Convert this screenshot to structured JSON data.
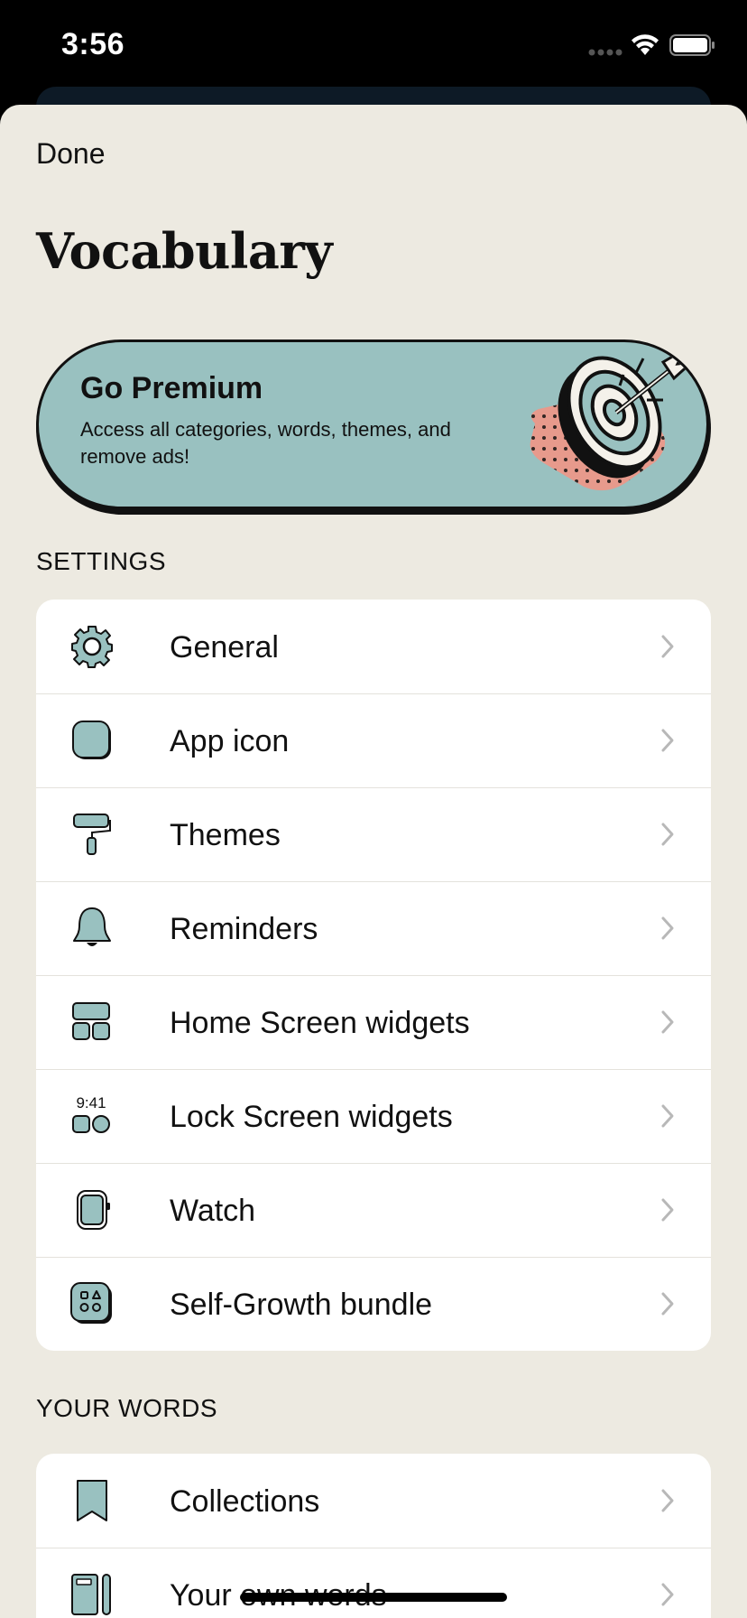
{
  "status_bar": {
    "time": "3:56"
  },
  "header": {
    "done_label": "Done",
    "title": "Vocabulary"
  },
  "premium": {
    "title": "Go Premium",
    "subtitle": "Access all categories, words, themes, and remove ads!"
  },
  "settings": {
    "section_label": "SETTINGS",
    "items": [
      {
        "label": "General",
        "icon": "gear-icon"
      },
      {
        "label": "App icon",
        "icon": "app-icon-icon"
      },
      {
        "label": "Themes",
        "icon": "paint-roller-icon"
      },
      {
        "label": "Reminders",
        "icon": "bell-icon"
      },
      {
        "label": "Home Screen widgets",
        "icon": "widgets-icon"
      },
      {
        "label": "Lock Screen widgets",
        "icon": "lock-screen-widgets-icon",
        "icon_text": "9:41"
      },
      {
        "label": "Watch",
        "icon": "watch-icon"
      },
      {
        "label": "Self-Growth bundle",
        "icon": "bundle-icon"
      }
    ]
  },
  "your_words": {
    "section_label": "YOUR WORDS",
    "items": [
      {
        "label": "Collections",
        "icon": "bookmark-icon"
      },
      {
        "label": "Your own words",
        "icon": "notebook-pencil-icon"
      }
    ]
  },
  "colors": {
    "accent": "#99c1c0",
    "sheet_bg": "#edeae1",
    "target_dots": "#e79a8c"
  }
}
